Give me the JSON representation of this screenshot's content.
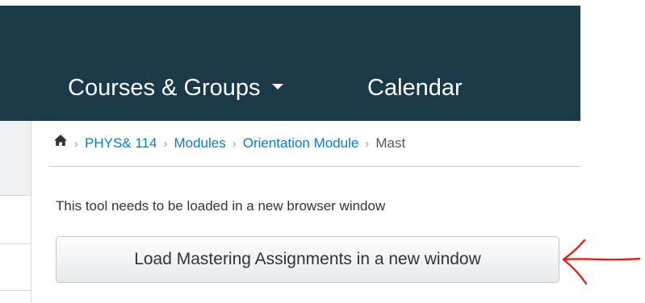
{
  "nav": {
    "courses_label": "Courses & Groups",
    "calendar_label": "Calendar",
    "bg_color": "#1b3a49"
  },
  "breadcrumb": {
    "home_icon": "home-icon",
    "items": [
      {
        "label": "PHYS& 114"
      },
      {
        "label": "Modules"
      },
      {
        "label": "Orientation Module"
      }
    ],
    "current": "Mast"
  },
  "content": {
    "tool_text": "This tool needs to be loaded in a new browser window",
    "load_button_label": "Load Mastering Assignments in a new window"
  },
  "colors": {
    "link": "#0b7bc1",
    "annotation": "#e0201c"
  }
}
